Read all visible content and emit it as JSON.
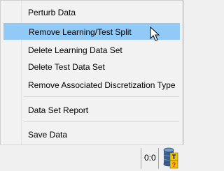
{
  "menu": {
    "items": [
      {
        "label": "Perturb Data"
      },
      {
        "label": "Remove Learning/Test Split"
      },
      {
        "label": "Delete Learning Data Set"
      },
      {
        "label": "Delete Test Data Set"
      },
      {
        "label": "Remove Associated Discretization Type"
      },
      {
        "label": "Data Set Report"
      },
      {
        "label": "Save Data"
      }
    ],
    "highlighted_item": "Remove Learning/Test Split"
  },
  "statusbar": {
    "count_text": "0:0",
    "database_icon": "database-icon",
    "database_badges": [
      "T",
      "?"
    ]
  },
  "colors": {
    "highlight": "#91c9f7",
    "database_body": "#3d5f8c",
    "badge": "#f4c400"
  }
}
